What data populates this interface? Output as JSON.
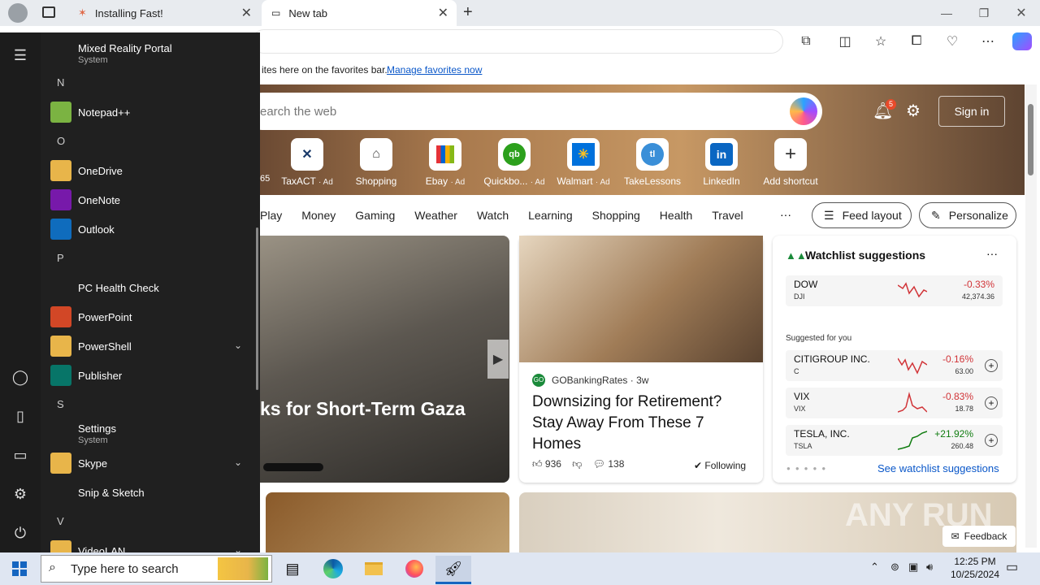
{
  "browser": {
    "tabs": [
      {
        "label": "Installing Fast!"
      },
      {
        "label": "New tab"
      }
    ],
    "favorites_bar": {
      "text": "ites here on the favorites bar.",
      "link": "Manage favorites now"
    }
  },
  "newtab": {
    "search_placeholder": "earch the web",
    "notification_count": "5",
    "signin_label": "Sign in",
    "shortcuts": [
      {
        "label": "TaxACT",
        "ad": "· Ad",
        "icon": "taxact-icon"
      },
      {
        "label": "Shopping",
        "ad": "",
        "icon": "tag-icon"
      },
      {
        "label": "Ebay",
        "ad": "· Ad",
        "icon": "ebay-icon"
      },
      {
        "label": "Quickbo...",
        "ad": "· Ad",
        "icon": "quickbooks-icon"
      },
      {
        "label": "Walmart",
        "ad": "· Ad",
        "icon": "walmart-icon"
      },
      {
        "label": "TakeLessons",
        "ad": "",
        "icon": "takelessons-icon"
      },
      {
        "label": "LinkedIn",
        "ad": "",
        "icon": "linkedin-icon"
      },
      {
        "label": "Add shortcut",
        "ad": "",
        "icon": "plus-icon"
      }
    ],
    "partial_shortcut_label": "65",
    "nav": [
      "Play",
      "Money",
      "Gaming",
      "Weather",
      "Watch",
      "Learning",
      "Shopping",
      "Health",
      "Travel"
    ],
    "nav_more": "···",
    "feed_layout_label": "Feed layout",
    "personalize_label": "Personalize",
    "card1": {
      "title": "ks for Short-Term Gaza"
    },
    "card2": {
      "source": "GOBankingRates",
      "age": "· 3w",
      "title": "Downsizing for Retirement? Stay Away From These 7 Homes",
      "likes": "936",
      "comments": "138",
      "following": "Following"
    },
    "watchlist": {
      "title": "Watchlist suggestions",
      "suggested_label": "Suggested for you",
      "see_more": "See watchlist suggestions",
      "items": [
        {
          "name": "DOW",
          "ticker": "DJI",
          "change": "-0.33%",
          "price": "42,374.36",
          "color": "#d13438"
        },
        {
          "name": "CITIGROUP INC.",
          "ticker": "C",
          "change": "-0.16%",
          "price": "63.00",
          "color": "#d13438"
        },
        {
          "name": "VIX",
          "ticker": "VIX",
          "change": "-0.83%",
          "price": "18.78",
          "color": "#d13438"
        },
        {
          "name": "TESLA, INC.",
          "ticker": "TSLA",
          "change": "+21.92%",
          "price": "260.48",
          "color": "#107c10"
        }
      ]
    },
    "feedback_label": "Feedback",
    "watermark": "ANY RUN"
  },
  "start_menu": {
    "items": [
      {
        "type": "app",
        "label": "Mixed Reality Portal",
        "sub": "System",
        "icon": "mixed-reality-icon",
        "color": "#202020"
      },
      {
        "type": "letter",
        "label": "N"
      },
      {
        "type": "app",
        "label": "Notepad++",
        "icon": "notepadpp-icon",
        "color": "#7bb342"
      },
      {
        "type": "letter",
        "label": "O"
      },
      {
        "type": "app",
        "label": "OneDrive",
        "icon": "onedrive-icon",
        "color": "#e8b54a"
      },
      {
        "type": "app",
        "label": "OneNote",
        "icon": "onenote-icon",
        "color": "#7719aa"
      },
      {
        "type": "app",
        "label": "Outlook",
        "icon": "outlook-icon",
        "color": "#0f6cbd"
      },
      {
        "type": "letter",
        "label": "P"
      },
      {
        "type": "app",
        "label": "PC Health Check",
        "icon": "pc-health-icon",
        "color": "#202020"
      },
      {
        "type": "app",
        "label": "PowerPoint",
        "icon": "powerpoint-icon",
        "color": "#d24726"
      },
      {
        "type": "app",
        "label": "PowerShell",
        "icon": "folder-icon",
        "color": "#e8b54a",
        "expand": true
      },
      {
        "type": "app",
        "label": "Publisher",
        "icon": "publisher-icon",
        "color": "#077568"
      },
      {
        "type": "letter",
        "label": "S"
      },
      {
        "type": "app",
        "label": "Settings",
        "sub": "System",
        "icon": "settings-icon",
        "color": "#202020"
      },
      {
        "type": "app",
        "label": "Skype",
        "icon": "folder-icon",
        "color": "#e8b54a",
        "expand": true
      },
      {
        "type": "app",
        "label": "Snip & Sketch",
        "icon": "snip-sketch-icon",
        "color": "#202020"
      },
      {
        "type": "letter",
        "label": "V"
      },
      {
        "type": "app",
        "label": "VideoLAN",
        "icon": "folder-icon",
        "color": "#e8b54a",
        "expand": true
      }
    ]
  },
  "taskbar": {
    "search_placeholder": "Type here to search",
    "time": "12:25 PM",
    "date": "10/25/2024"
  }
}
